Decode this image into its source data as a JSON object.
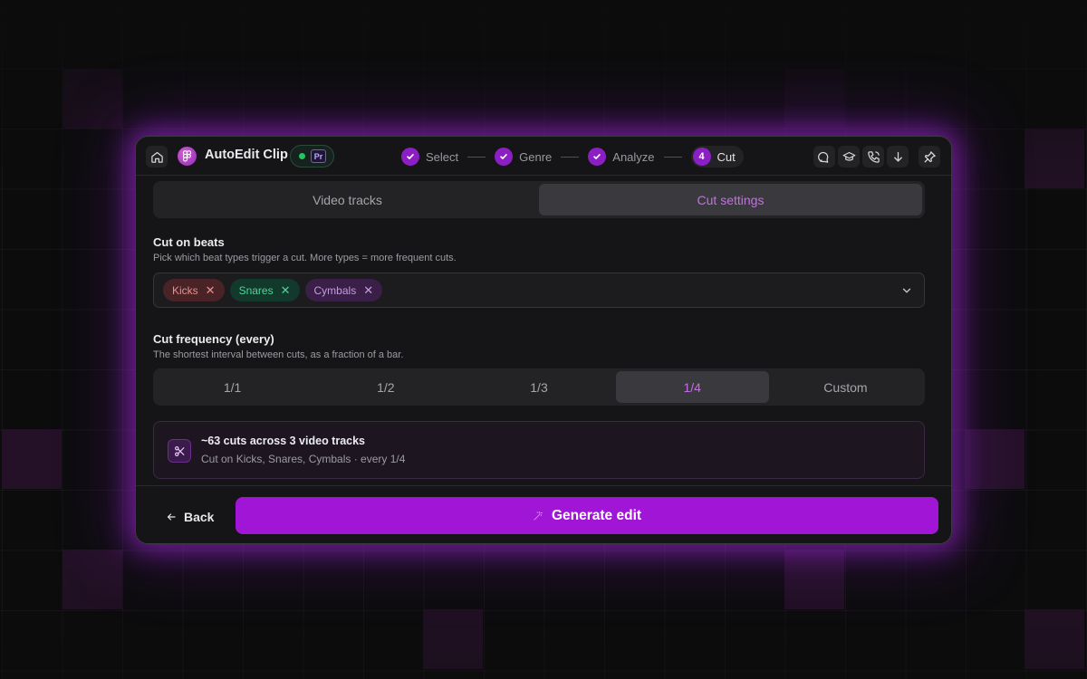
{
  "app": {
    "title": "AutoEdit Clip",
    "host_badge": "Pr"
  },
  "steps": [
    {
      "label": "Select",
      "state": "done"
    },
    {
      "label": "Genre",
      "state": "done"
    },
    {
      "label": "Analyze",
      "state": "done"
    },
    {
      "label": "Cut",
      "number": "4",
      "state": "current"
    }
  ],
  "header_tools": [
    "chat-icon",
    "graduation-cap-icon",
    "phone-icon",
    "download-icon",
    "pin-icon"
  ],
  "tabs": [
    {
      "label": "Video tracks",
      "active": false
    },
    {
      "label": "Cut settings",
      "active": true
    }
  ],
  "cut_on_beats": {
    "title": "Cut on beats",
    "subtitle": "Pick which beat types trigger a cut. More types = more frequent cuts.",
    "selected": [
      {
        "label": "Kicks",
        "color": "#ee8e8c"
      },
      {
        "label": "Snares",
        "color": "#4bd79a"
      },
      {
        "label": "Cymbals",
        "color": "#c99be0"
      }
    ]
  },
  "cut_frequency": {
    "title": "Cut frequency (every)",
    "subtitle": "The shortest interval between cuts, as a fraction of a bar.",
    "options": [
      "1/1",
      "1/2",
      "1/3",
      "1/4",
      "Custom"
    ],
    "selected": "1/4"
  },
  "summary": {
    "title": "~63 cuts across 3 video tracks",
    "detail": "Cut on Kicks, Snares, Cymbals · every 1/4"
  },
  "footer": {
    "back_label": "Back",
    "generate_label": "Generate edit"
  },
  "colors": {
    "accent": "#a116d6",
    "step_done": "#8b1fc4",
    "active_tab_text": "#c56ee6"
  }
}
